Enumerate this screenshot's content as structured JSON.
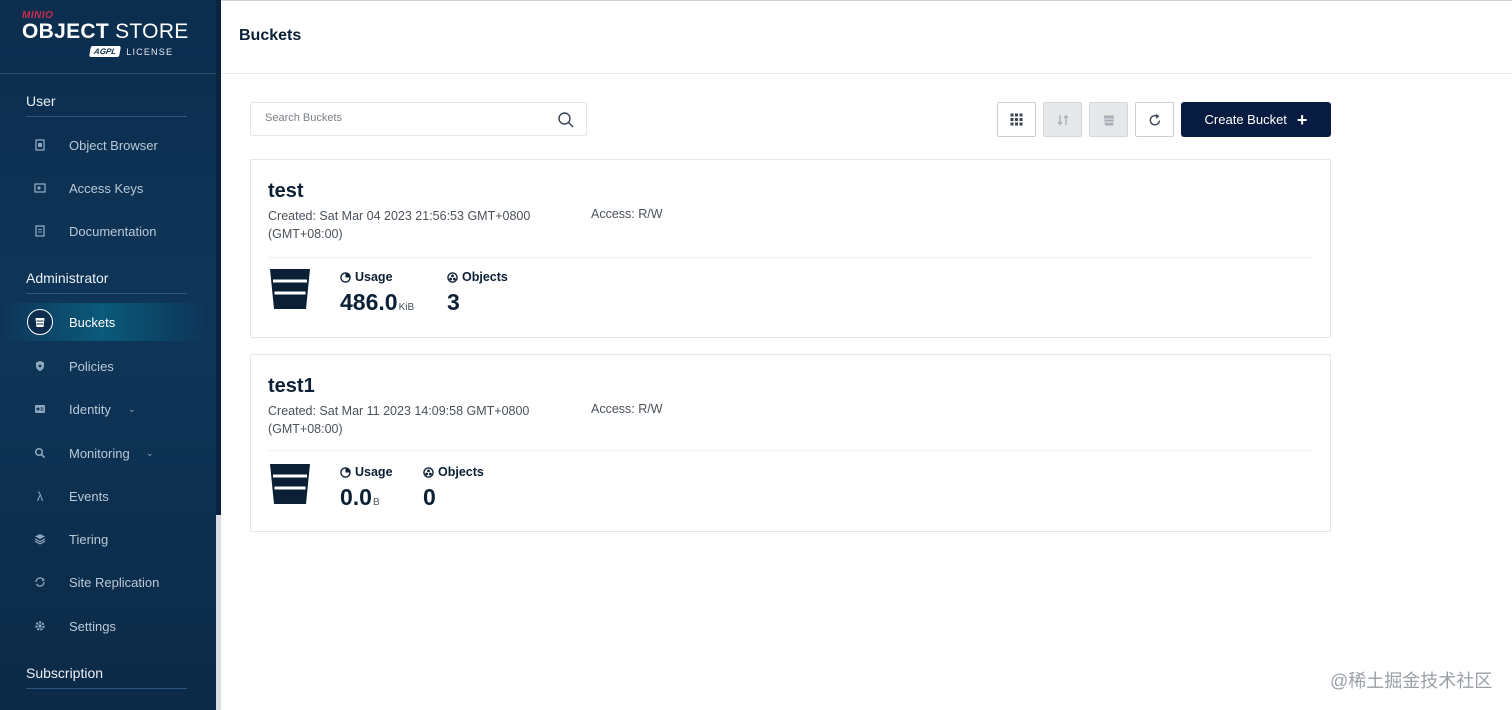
{
  "app": {
    "logo_brand": "MINIO",
    "logo_title_bold": "OBJECT",
    "logo_title_light": "STORE",
    "logo_agpl": "AGPL",
    "logo_license": "LICENSE"
  },
  "sidebar": {
    "sections": [
      {
        "title": "User"
      },
      {
        "title": "Administrator"
      },
      {
        "title": "Subscription"
      }
    ],
    "user_items": [
      {
        "label": "Object Browser",
        "icon": "object-browser-icon"
      },
      {
        "label": "Access Keys",
        "icon": "access-keys-icon"
      },
      {
        "label": "Documentation",
        "icon": "documentation-icon"
      }
    ],
    "admin_items": [
      {
        "label": "Buckets",
        "icon": "bucket-icon",
        "active": true
      },
      {
        "label": "Policies",
        "icon": "policies-icon"
      },
      {
        "label": "Identity",
        "icon": "identity-icon",
        "expandable": true
      },
      {
        "label": "Monitoring",
        "icon": "monitoring-icon",
        "expandable": true
      },
      {
        "label": "Events",
        "icon": "lambda-icon"
      },
      {
        "label": "Tiering",
        "icon": "tiering-icon"
      },
      {
        "label": "Site Replication",
        "icon": "replication-icon"
      },
      {
        "label": "Settings",
        "icon": "gear-icon"
      }
    ]
  },
  "header": {
    "title": "Buckets"
  },
  "toolbar": {
    "search_placeholder": "Search Buckets",
    "create_label": "Create Bucket"
  },
  "buckets": [
    {
      "name": "test",
      "created": "Created: Sat Mar 04 2023 21:56:53 GMT+0800 (GMT+08:00)",
      "access": "Access: R/W",
      "usage_label": "Usage",
      "usage_value": "486.0",
      "usage_unit": "KiB",
      "objects_label": "Objects",
      "objects_value": "3"
    },
    {
      "name": "test1",
      "created": "Created: Sat Mar 11 2023 14:09:58 GMT+0800 (GMT+08:00)",
      "access": "Access: R/W",
      "usage_label": "Usage",
      "usage_value": "0.0",
      "usage_unit": "B",
      "objects_label": "Objects",
      "objects_value": "0"
    }
  ],
  "watermark": "@稀土掘金技术社区",
  "colors": {
    "sidebar_bg": "#0c2d4e",
    "primary_button": "#081c42",
    "heading": "#0b1f35"
  }
}
